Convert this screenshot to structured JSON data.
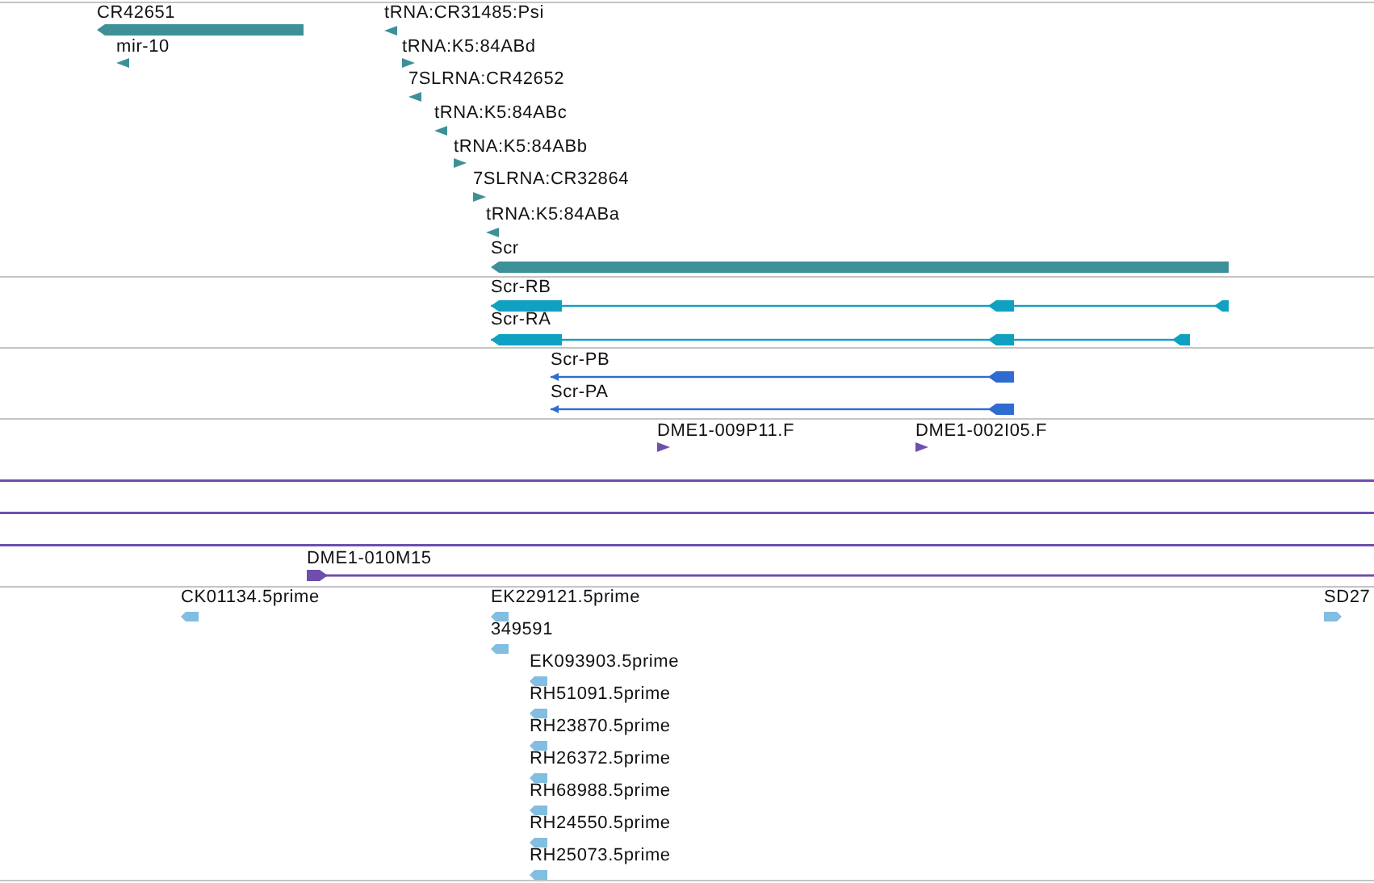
{
  "tracks": [
    {
      "kind": "gene",
      "color": "#3e9098",
      "features": [
        {
          "label": "CR42651",
          "reverse": true
        },
        {
          "label": "mir-10",
          "reverse": true
        },
        {
          "label": "tRNA:CR31485:Psi",
          "reverse": true
        },
        {
          "label": "tRNA:K5:84ABd",
          "reverse": false
        },
        {
          "label": "7SLRNA:CR42652",
          "reverse": true
        },
        {
          "label": "tRNA:K5:84ABc",
          "reverse": true
        },
        {
          "label": "tRNA:K5:84ABb",
          "reverse": false
        },
        {
          "label": "7SLRNA:CR32864",
          "reverse": false
        },
        {
          "label": "tRNA:K5:84ABa",
          "reverse": true
        },
        {
          "label": "Scr",
          "reverse": true
        }
      ]
    },
    {
      "kind": "transcript",
      "color": "#0fa0c2",
      "features": [
        {
          "label": "Scr-RB",
          "reverse": true
        },
        {
          "label": "Scr-RA",
          "reverse": true
        }
      ]
    },
    {
      "kind": "protein",
      "color": "#2f6ccf",
      "features": [
        {
          "label": "Scr-PB",
          "reverse": true
        },
        {
          "label": "Scr-PA",
          "reverse": true
        }
      ]
    },
    {
      "kind": "clone",
      "color": "#6e4fae",
      "features": [
        {
          "kind": "clone",
          "label": "DME1-009P11.F",
          "reverse": false
        },
        {
          "kind": "clone",
          "label": "DME1-002I05.F",
          "reverse": false
        },
        {
          "kind": "span"
        },
        {
          "kind": "span"
        },
        {
          "kind": "span"
        },
        {
          "kind": "clone",
          "label": "DME1-010M15",
          "reverse": false
        }
      ]
    },
    {
      "kind": "est",
      "color": "#82bde2",
      "features": [
        {
          "label": "CK01134.5prime",
          "reverse": true
        },
        {
          "label": "EK229121.5prime",
          "reverse": true
        },
        {
          "label": "349591",
          "reverse": true
        },
        {
          "label": "EK093903.5prime",
          "reverse": true
        },
        {
          "label": "RH51091.5prime",
          "reverse": true
        },
        {
          "label": "RH23870.5prime",
          "reverse": true
        },
        {
          "label": "RH26372.5prime",
          "reverse": true
        },
        {
          "label": "RH68988.5prime",
          "reverse": true
        },
        {
          "label": "RH24550.5prime",
          "reverse": true
        },
        {
          "label": "RH25073.5prime",
          "reverse": true
        },
        {
          "label": "SD27",
          "reverse": false
        }
      ]
    }
  ]
}
